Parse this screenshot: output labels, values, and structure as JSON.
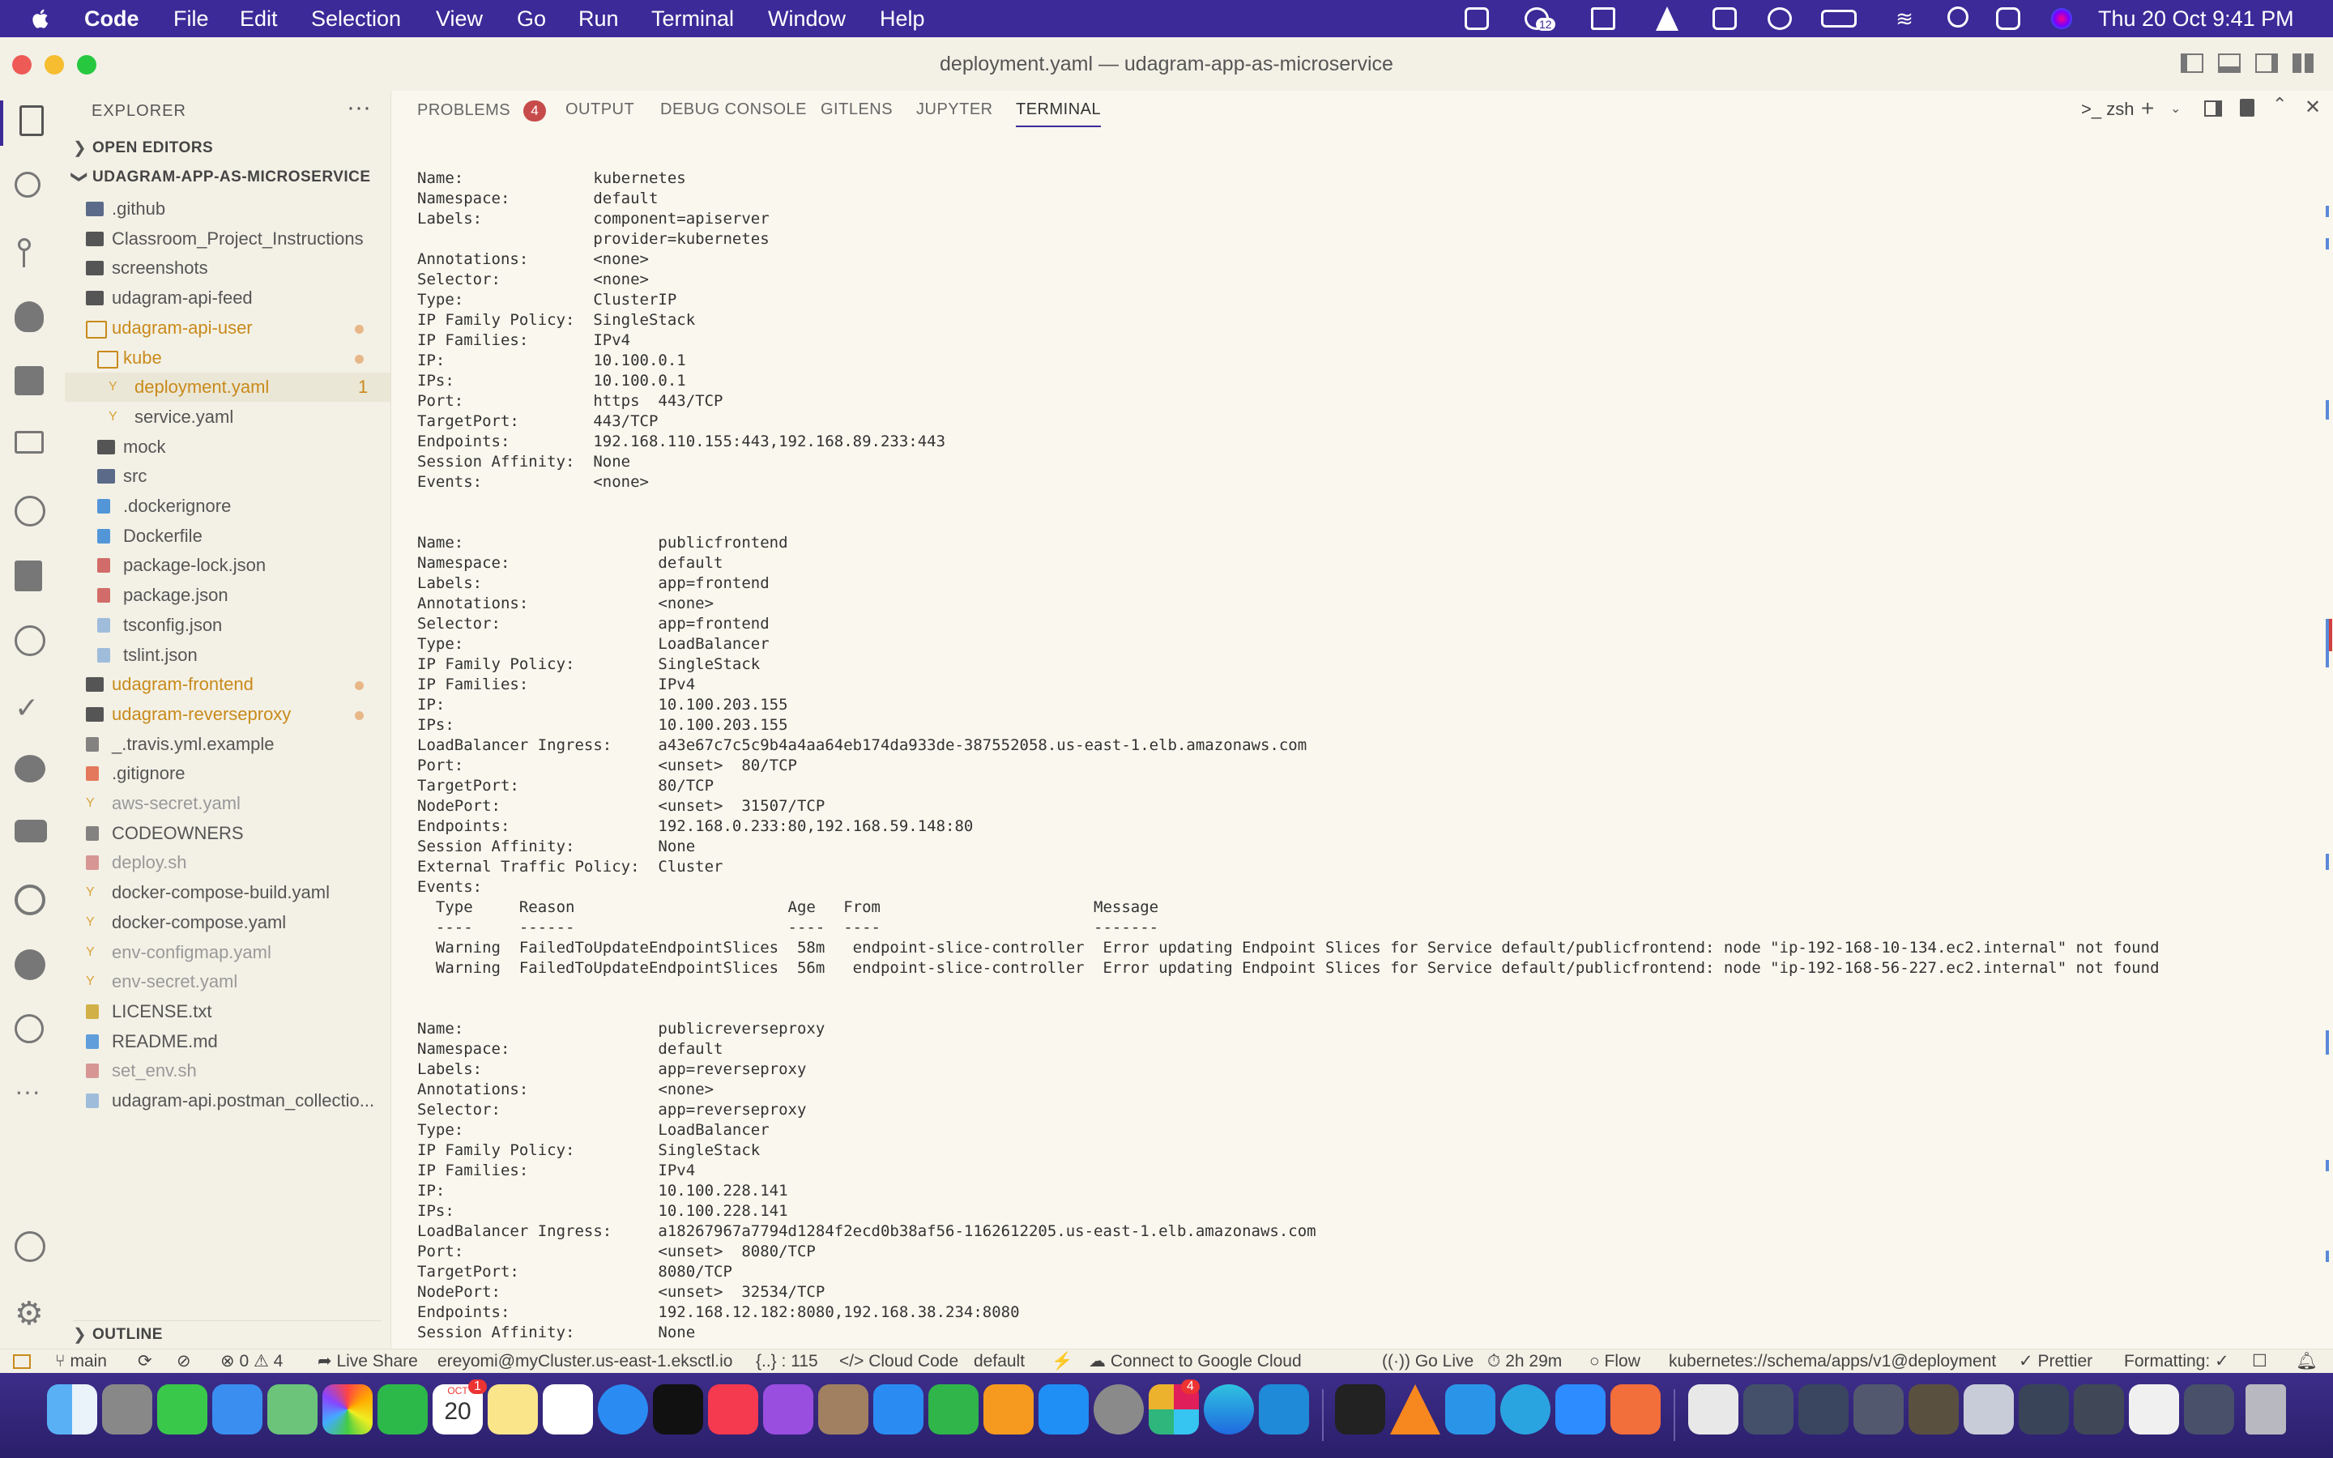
{
  "menubar": {
    "app": "Code",
    "items": [
      "File",
      "Edit",
      "Selection",
      "View",
      "Go",
      "Run",
      "Terminal",
      "Window",
      "Help"
    ],
    "clock": "Thu 20 Oct  9:41 PM",
    "notification_badge": "12"
  },
  "window": {
    "title": "deployment.yaml — udagram-app-as-microservice"
  },
  "explorer": {
    "header": "EXPLORER",
    "open_editors": "OPEN EDITORS",
    "root": "UDAGRAM-APP-AS-MICROSERVICE",
    "outline": "OUTLINE",
    "items": [
      {
        "label": ".github",
        "depth": 0,
        "kind": "folder-special",
        "color": "#555555"
      },
      {
        "label": "Classroom_Project_Instructions",
        "depth": 0,
        "kind": "folder",
        "color": "#555555"
      },
      {
        "label": "screenshots",
        "depth": 0,
        "kind": "folder",
        "color": "#555555"
      },
      {
        "label": "udagram-api-feed",
        "depth": 0,
        "kind": "folder",
        "color": "#555555"
      },
      {
        "label": "udagram-api-user",
        "depth": 0,
        "kind": "folder-open",
        "color": "#c98a1b",
        "modified": true
      },
      {
        "label": "kube",
        "depth": 1,
        "kind": "folder-open",
        "color": "#c98a1b",
        "modified": true
      },
      {
        "label": "deployment.yaml",
        "depth": 2,
        "kind": "yaml",
        "color": "#c98a1b",
        "badge": "1",
        "selected": true
      },
      {
        "label": "service.yaml",
        "depth": 2,
        "kind": "yaml",
        "color": "#555555"
      },
      {
        "label": "mock",
        "depth": 1,
        "kind": "folder",
        "color": "#555555"
      },
      {
        "label": "src",
        "depth": 1,
        "kind": "folder-special",
        "color": "#555555"
      },
      {
        "label": ".dockerignore",
        "depth": 1,
        "kind": "docker",
        "color": "#555555"
      },
      {
        "label": "Dockerfile",
        "depth": 1,
        "kind": "docker",
        "color": "#555555"
      },
      {
        "label": "package-lock.json",
        "depth": 1,
        "kind": "npm",
        "color": "#555555"
      },
      {
        "label": "package.json",
        "depth": 1,
        "kind": "npm",
        "color": "#555555"
      },
      {
        "label": "tsconfig.json",
        "depth": 1,
        "kind": "json",
        "color": "#555555"
      },
      {
        "label": "tslint.json",
        "depth": 1,
        "kind": "json",
        "color": "#555555"
      },
      {
        "label": "udagram-frontend",
        "depth": 0,
        "kind": "folder",
        "color": "#c98a1b",
        "modified": true
      },
      {
        "label": "udagram-reverseproxy",
        "depth": 0,
        "kind": "folder",
        "color": "#c98a1b",
        "modified": true
      },
      {
        "label": "_.travis.yml.example",
        "depth": 0,
        "kind": "file",
        "color": "#555555"
      },
      {
        "label": ".gitignore",
        "depth": 0,
        "kind": "git",
        "color": "#555555"
      },
      {
        "label": "aws-secret.yaml",
        "depth": 0,
        "kind": "yaml",
        "color": "#999999"
      },
      {
        "label": "CODEOWNERS",
        "depth": 0,
        "kind": "file",
        "color": "#555555"
      },
      {
        "label": "deploy.sh",
        "depth": 0,
        "kind": "shell",
        "color": "#999999"
      },
      {
        "label": "docker-compose-build.yaml",
        "depth": 0,
        "kind": "yaml",
        "color": "#555555"
      },
      {
        "label": "docker-compose.yaml",
        "depth": 0,
        "kind": "yaml",
        "color": "#555555"
      },
      {
        "label": "env-configmap.yaml",
        "depth": 0,
        "kind": "yaml",
        "color": "#999999"
      },
      {
        "label": "env-secret.yaml",
        "depth": 0,
        "kind": "yaml",
        "color": "#999999"
      },
      {
        "label": "LICENSE.txt",
        "depth": 0,
        "kind": "license",
        "color": "#555555"
      },
      {
        "label": "README.md",
        "depth": 0,
        "kind": "info",
        "color": "#555555"
      },
      {
        "label": "set_env.sh",
        "depth": 0,
        "kind": "shell",
        "color": "#999999"
      },
      {
        "label": "udagram-api.postman_collectio...",
        "depth": 0,
        "kind": "json",
        "color": "#555555"
      }
    ]
  },
  "panel": {
    "tabs": [
      {
        "label": "PROBLEMS",
        "badge": "4"
      },
      {
        "label": "OUTPUT"
      },
      {
        "label": "DEBUG CONSOLE"
      },
      {
        "label": "GITLENS"
      },
      {
        "label": "JUPYTER"
      },
      {
        "label": "TERMINAL",
        "active": true
      }
    ],
    "shell": "zsh"
  },
  "terminal": {
    "lines": [
      "Name:              kubernetes",
      "Namespace:         default",
      "Labels:            component=apiserver",
      "                   provider=kubernetes",
      "Annotations:       <none>",
      "Selector:          <none>",
      "Type:              ClusterIP",
      "IP Family Policy:  SingleStack",
      "IP Families:       IPv4",
      "IP:                10.100.0.1",
      "IPs:               10.100.0.1",
      "Port:              https  443/TCP",
      "TargetPort:        443/TCP",
      "Endpoints:         192.168.110.155:443,192.168.89.233:443",
      "Session Affinity:  None",
      "Events:            <none>",
      "",
      "",
      "Name:                     publicfrontend",
      "Namespace:                default",
      "Labels:                   app=frontend",
      "Annotations:              <none>",
      "Selector:                 app=frontend",
      "Type:                     LoadBalancer",
      "IP Family Policy:         SingleStack",
      "IP Families:              IPv4",
      "IP:                       10.100.203.155",
      "IPs:                      10.100.203.155",
      "LoadBalancer Ingress:     a43e67c7c5c9b4a4aa64eb174da933de-387552058.us-east-1.elb.amazonaws.com",
      "Port:                     <unset>  80/TCP",
      "TargetPort:               80/TCP",
      "NodePort:                 <unset>  31507/TCP",
      "Endpoints:                192.168.0.233:80,192.168.59.148:80",
      "Session Affinity:         None",
      "External Traffic Policy:  Cluster",
      "Events:",
      "  Type     Reason                       Age   From                       Message",
      "  ----     ------                       ----  ----                       -------",
      "  Warning  FailedToUpdateEndpointSlices  58m   endpoint-slice-controller  Error updating Endpoint Slices for Service default/publicfrontend: node \"ip-192-168-10-134.ec2.internal\" not found",
      "  Warning  FailedToUpdateEndpointSlices  56m   endpoint-slice-controller  Error updating Endpoint Slices for Service default/publicfrontend: node \"ip-192-168-56-227.ec2.internal\" not found",
      "",
      "",
      "Name:                     publicreverseproxy",
      "Namespace:                default",
      "Labels:                   app=reverseproxy",
      "Annotations:              <none>",
      "Selector:                 app=reverseproxy",
      "Type:                     LoadBalancer",
      "IP Family Policy:         SingleStack",
      "IP Families:              IPv4",
      "IP:                       10.100.228.141",
      "IPs:                      10.100.228.141",
      "LoadBalancer Ingress:     a18267967a7794d1284f2ecd0b38af56-1162612205.us-east-1.elb.amazonaws.com",
      "Port:                     <unset>  8080/TCP",
      "TargetPort:               8080/TCP",
      "NodePort:                 <unset>  32534/TCP",
      "Endpoints:                192.168.12.182:8080,192.168.38.234:8080",
      "Session Affinity:         None"
    ]
  },
  "statusbar": {
    "branch": "main",
    "errors": "0",
    "warnings": "4",
    "live_share": "Live Share",
    "cluster": "ereyomi@myCluster.us-east-1.eksctl.io",
    "json_path": "{..} : 115",
    "cloud_code": "Cloud Code",
    "namespace": "default",
    "google_cloud": "Connect to Google Cloud",
    "go_live": "Go Live",
    "timer": "2h 29m",
    "flow": "Flow",
    "schema": "kubernetes://schema/apps/v1@deployment",
    "prettier": "Prettier",
    "formatting": "Formatting: ✓"
  },
  "dock": {
    "calendar_month": "OCT",
    "calendar_day": "20",
    "calendar_badge": "1",
    "slack_badge": "4"
  },
  "colors": {
    "menubar": "#3b2a98",
    "accent_orange": "#c98a1b",
    "badge": "#c74b4b"
  }
}
